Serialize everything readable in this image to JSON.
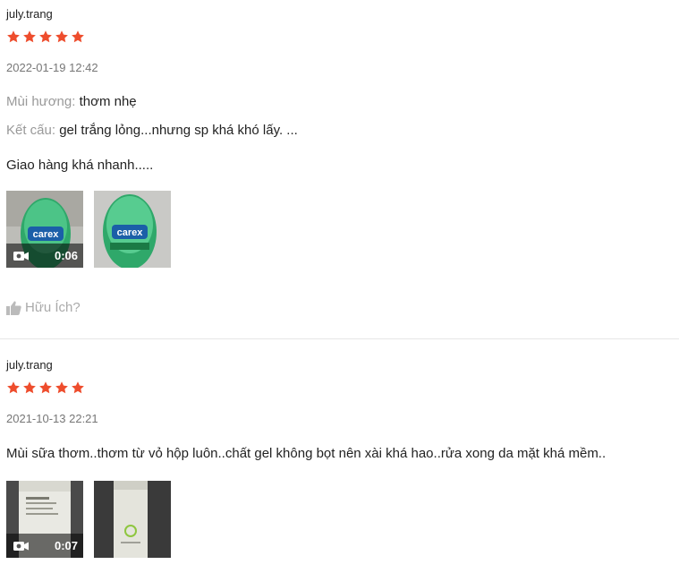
{
  "reviews": [
    {
      "username": "july.trang",
      "rating": 5,
      "datetime": "2022-01-19 12:42",
      "attributes": [
        {
          "label": "Mùi hương:",
          "value": "thơm nhẹ"
        },
        {
          "label": "Kết cấu:",
          "value": "gel trắng lỏng...nhưng sp khá khó lấy. ..."
        }
      ],
      "text": "Giao hàng khá nhanh.....",
      "media": [
        {
          "type": "video",
          "duration": "0:06",
          "icon": "video-camera-icon"
        },
        {
          "type": "image"
        }
      ],
      "helpful_label": "Hữu Ích?"
    },
    {
      "username": "july.trang",
      "rating": 5,
      "datetime": "2021-10-13 22:21",
      "text": "Mùi sữa thơm..thơm từ vỏ hộp luôn..chất gel không bọt nên xài khá hao..rửa xong da mặt khá mềm..",
      "media": [
        {
          "type": "video",
          "duration": "0:07",
          "icon": "video-camera-icon"
        },
        {
          "type": "image"
        }
      ]
    }
  ],
  "colors": {
    "star": "#ee4d2d",
    "muted": "#999999",
    "divider": "#e6e6e6"
  }
}
